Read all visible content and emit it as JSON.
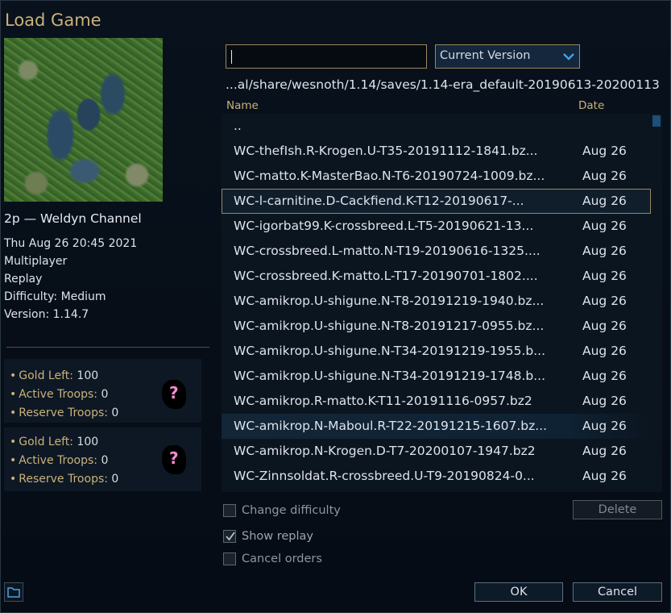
{
  "title": "Load Game",
  "preview": {
    "map_name": "2p — Weldyn Channel",
    "details": [
      "Thu Aug 26 20:45 2021",
      "Multiplayer",
      "Replay",
      "Difficulty: Medium",
      "Version: 1.14.7"
    ],
    "players": [
      {
        "gold_label": "Gold Left:",
        "gold": "100",
        "active_label": "Active Troops:",
        "active": "0",
        "reserve_label": "Reserve Troops:",
        "reserve": "0",
        "faction_icon": "unknown-leader-icon",
        "faction_glyph": "?"
      },
      {
        "gold_label": "Gold Left:",
        "gold": "100",
        "active_label": "Active Troops:",
        "active": "0",
        "reserve_label": "Reserve Troops:",
        "reserve": "0",
        "faction_icon": "unknown-leader-icon",
        "faction_glyph": "?"
      }
    ]
  },
  "filter": {
    "value": ""
  },
  "version_select": {
    "selected": "Current Version"
  },
  "path": "...al/share/wesnoth/1.14/saves/1.14-era_default-20190613-20200113",
  "columns": {
    "name": "Name",
    "date": "Date"
  },
  "files": [
    {
      "name": "..",
      "date": ""
    },
    {
      "name": "WC-thefIsh.R-Krogen.U-T35-20191112-1841.bz...",
      "date": "Aug 26"
    },
    {
      "name": "WC-matto.K-MasterBao.N-T6-20190724-1009.bz...",
      "date": "Aug 26"
    },
    {
      "name": "WC-l-carnitine.D-Cackfiend.K-T12-20190617-...",
      "date": "Aug 26"
    },
    {
      "name": "WC-igorbat99.K-crossbreed.L-T5-20190621-13...",
      "date": "Aug 26"
    },
    {
      "name": "WC-crossbreed.L-matto.N-T19-20190616-1325....",
      "date": "Aug 26"
    },
    {
      "name": "WC-crossbreed.K-matto.L-T17-20190701-1802....",
      "date": "Aug 26"
    },
    {
      "name": "WC-amikrop.U-shigune.N-T8-20191219-1940.bz...",
      "date": "Aug 26"
    },
    {
      "name": "WC-amikrop.U-shigune.N-T8-20191217-0955.bz...",
      "date": "Aug 26"
    },
    {
      "name": "WC-amikrop.U-shigune.N-T34-20191219-1955.b...",
      "date": "Aug 26"
    },
    {
      "name": "WC-amikrop.U-shigune.N-T34-20191219-1748.b...",
      "date": "Aug 26"
    },
    {
      "name": "WC-amikrop.R-matto.K-T11-20191116-0957.bz2",
      "date": "Aug 26"
    },
    {
      "name": "WC-amikrop.N-Maboul.R-T22-20191215-1607.bz...",
      "date": "Aug 26"
    },
    {
      "name": "WC-amikrop.N-Krogen.D-T7-20200107-1947.bz2",
      "date": "Aug 26"
    },
    {
      "name": "WC-Zinnsoldat.R-crossbreed.U-T9-20190824-0...",
      "date": "Aug 26"
    }
  ],
  "options": {
    "change_difficulty": "Change difficulty",
    "show_replay": "Show replay",
    "cancel_orders": "Cancel orders"
  },
  "buttons": {
    "delete": "Delete",
    "ok": "OK",
    "cancel": "Cancel"
  },
  "colors": {
    "accent_gold": "#c9b27a",
    "selection_border": "#9a875f",
    "background": "#050b13"
  }
}
